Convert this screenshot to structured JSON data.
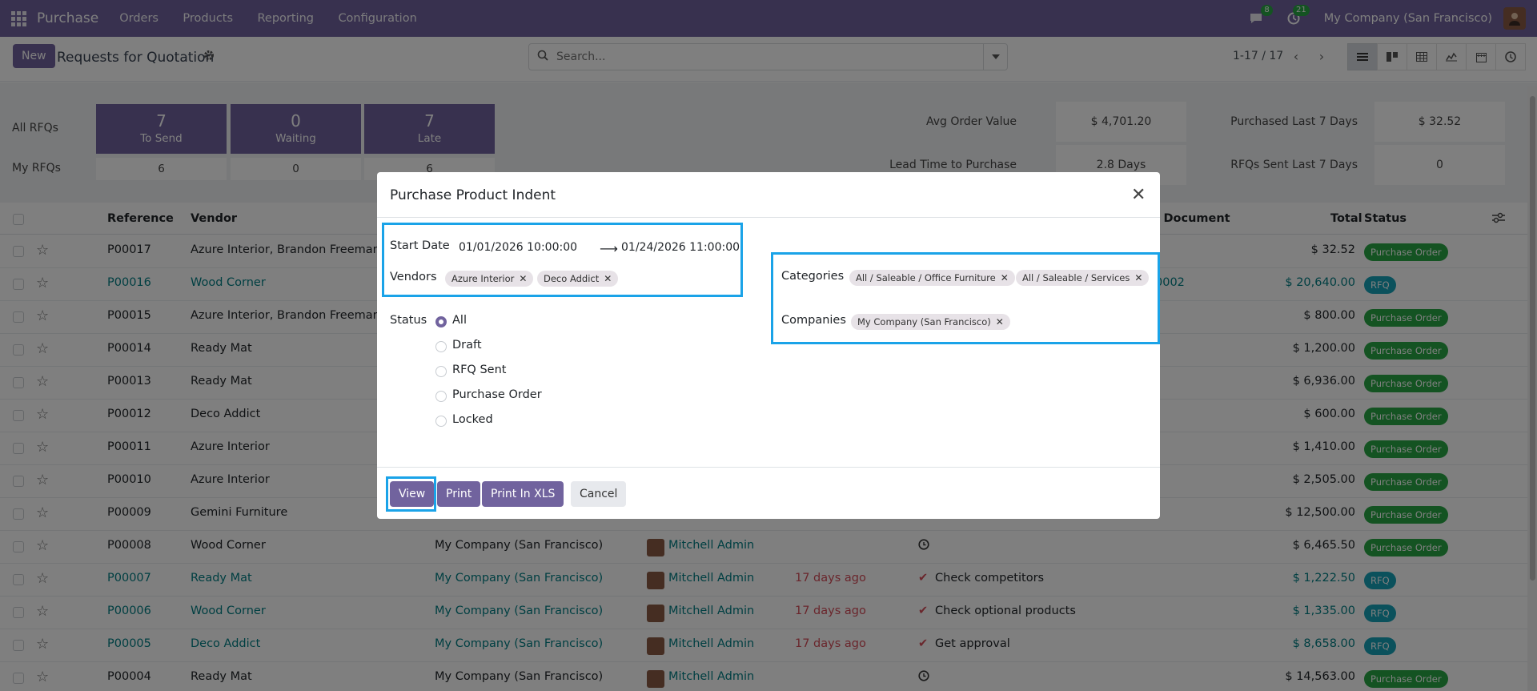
{
  "topbar": {
    "app_name": "Purchase",
    "menu": [
      "Orders",
      "Products",
      "Reporting",
      "Configuration"
    ],
    "messages_count": "8",
    "activities_count": "21",
    "company": "My Company (San Francisco)"
  },
  "control_panel": {
    "new_label": "New",
    "title": "Requests for Quotation",
    "search_placeholder": "Search...",
    "pager": "1-17 / 17"
  },
  "dashboard": {
    "all_rfqs_label": "All RFQs",
    "my_rfqs_label": "My RFQs",
    "cards": [
      {
        "value": "7",
        "label": "To Send",
        "mine": "6"
      },
      {
        "value": "0",
        "label": "Waiting",
        "mine": "0"
      },
      {
        "value": "7",
        "label": "Late",
        "mine": "6"
      }
    ],
    "avg_order_value_label": "Avg Order Value",
    "avg_order_value": "$ 4,701.20",
    "purchased_7_label": "Purchased Last 7 Days",
    "purchased_7": "$ 32.52",
    "lead_time_label": "Lead Time to Purchase",
    "lead_time": "2.8 Days",
    "rfqs_sent_label": "RFQs Sent Last 7 Days",
    "rfqs_sent": "0"
  },
  "table": {
    "headers": {
      "reference": "Reference",
      "vendor": "Vendor",
      "source_document": "ce Document",
      "total": "Total",
      "status": "Status"
    },
    "rows": [
      {
        "ref": "P00017",
        "vendor": "Azure Interior, Brandon Freeman",
        "company": "",
        "buyer": "",
        "deadline": "",
        "activity": "",
        "source": "",
        "total": "$ 32.52",
        "status": "Purchase Order"
      },
      {
        "ref": "P00016",
        "vendor": "Wood Corner",
        "company": "",
        "buyer": "",
        "deadline": "",
        "activity": "",
        "source": "0002",
        "total": "$ 20,640.00",
        "status": "RFQ"
      },
      {
        "ref": "P00015",
        "vendor": "Azure Interior, Brandon Freeman",
        "company": "",
        "buyer": "",
        "deadline": "",
        "activity": "",
        "source": "",
        "total": "$ 800.00",
        "status": "Purchase Order"
      },
      {
        "ref": "P00014",
        "vendor": "Ready Mat",
        "company": "",
        "buyer": "",
        "deadline": "",
        "activity": "",
        "source": "",
        "total": "$ 1,200.00",
        "status": "Purchase Order"
      },
      {
        "ref": "P00013",
        "vendor": "Ready Mat",
        "company": "",
        "buyer": "",
        "deadline": "",
        "activity": "",
        "source": "",
        "total": "$ 6,936.00",
        "status": "Purchase Order"
      },
      {
        "ref": "P00012",
        "vendor": "Deco Addict",
        "company": "",
        "buyer": "",
        "deadline": "",
        "activity": "",
        "source": "",
        "total": "$ 600.00",
        "status": "Purchase Order"
      },
      {
        "ref": "P00011",
        "vendor": "Azure Interior",
        "company": "",
        "buyer": "",
        "deadline": "",
        "activity": "",
        "source": "",
        "total": "$ 1,410.00",
        "status": "Purchase Order"
      },
      {
        "ref": "P00010",
        "vendor": "Azure Interior",
        "company": "",
        "buyer": "",
        "deadline": "",
        "activity": "",
        "source": "",
        "total": "$ 2,505.00",
        "status": "Purchase Order"
      },
      {
        "ref": "P00009",
        "vendor": "Gemini Furniture",
        "company": "",
        "buyer": "",
        "deadline": "",
        "activity": "",
        "source": "",
        "total": "$ 12,500.00",
        "status": "Purchase Order"
      },
      {
        "ref": "P00008",
        "vendor": "Wood Corner",
        "company": "My Company (San Francisco)",
        "buyer": "Mitchell Admin",
        "deadline": "",
        "activity": "",
        "source": "",
        "total": "$ 6,465.50",
        "status": "Purchase Order"
      },
      {
        "ref": "P00007",
        "vendor": "Ready Mat",
        "company": "My Company (San Francisco)",
        "buyer": "Mitchell Admin",
        "deadline": "17 days ago",
        "activity": "Check competitors",
        "source": "",
        "total": "$ 1,222.50",
        "status": "RFQ"
      },
      {
        "ref": "P00006",
        "vendor": "Wood Corner",
        "company": "My Company (San Francisco)",
        "buyer": "Mitchell Admin",
        "deadline": "17 days ago",
        "activity": "Check optional products",
        "source": "",
        "total": "$ 1,335.00",
        "status": "RFQ"
      },
      {
        "ref": "P00005",
        "vendor": "Deco Addict",
        "company": "My Company (San Francisco)",
        "buyer": "Mitchell Admin",
        "deadline": "17 days ago",
        "activity": "Get approval",
        "source": "",
        "total": "$ 8,658.00",
        "status": "RFQ"
      },
      {
        "ref": "P00004",
        "vendor": "Ready Mat",
        "company": "My Company (San Francisco)",
        "buyer": "Mitchell Admin",
        "deadline": "",
        "activity": "",
        "source": "",
        "total": "$ 14,563.00",
        "status": "Purchase Order"
      }
    ]
  },
  "modal": {
    "title": "Purchase Product Indent",
    "start_date_label": "Start Date",
    "start_date": "01/01/2026 10:00:00",
    "end_date": "01/24/2026 11:00:00",
    "vendors_label": "Vendors",
    "vendors": [
      "Azure Interior",
      "Deco Addict"
    ],
    "categories_label": "Categories",
    "categories": [
      "All / Saleable / Office Furniture",
      "All / Saleable / Services"
    ],
    "companies_label": "Companies",
    "companies": [
      "My Company (San Francisco)"
    ],
    "status_label": "Status",
    "status_options": [
      "All",
      "Draft",
      "RFQ Sent",
      "Purchase Order",
      "Locked"
    ],
    "status_selected": "All",
    "buttons": {
      "view": "View",
      "print": "Print",
      "print_xls": "Print In XLS",
      "cancel": "Cancel"
    }
  },
  "colors": {
    "brand": "#71639e",
    "highlight": "#1aa3e8",
    "purchase_order_badge": "#28a745",
    "rfq_badge": "#17a2b8",
    "link": "#017e84",
    "late": "#d44c59"
  }
}
